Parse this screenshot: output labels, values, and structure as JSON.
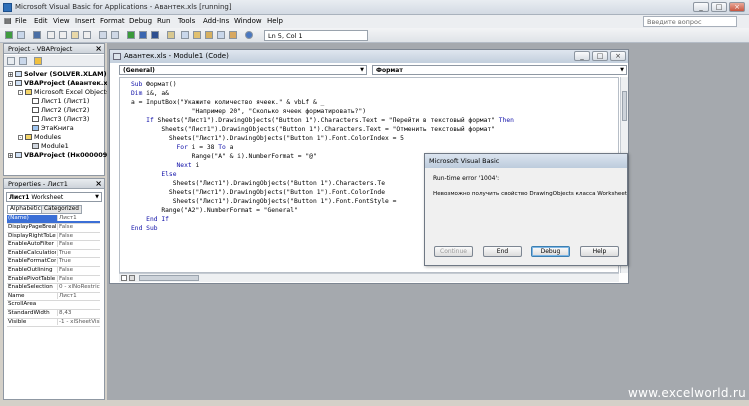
{
  "window": {
    "title": "Microsoft Visual Basic for Applications - Авантек.xls [running]",
    "controls": [
      "_",
      "□",
      "×"
    ]
  },
  "menu": {
    "items": [
      "File",
      "Edit",
      "View",
      "Insert",
      "Format",
      "Debug",
      "Run",
      "Tools",
      "Add-Ins",
      "Window",
      "Help"
    ],
    "ask_placeholder": "Введите вопрос"
  },
  "toolbar": {
    "cursor_position": "Ln 5, Col 1"
  },
  "project_panel": {
    "title": "Project - VBAProject",
    "tree": [
      {
        "label": "Solver (SOLVER.XLAM)",
        "bold": true
      },
      {
        "label": "VBAProject (Авантек.x",
        "bold": true
      },
      {
        "label": "Microsoft Excel Objects",
        "bold": false
      },
      {
        "label": "Лист1 (Лист1)",
        "bold": false
      },
      {
        "label": "Лист2 (Лист2)",
        "bold": false
      },
      {
        "label": "Лист3 (Лист3)",
        "bold": false
      },
      {
        "label": "ЭтаКнига",
        "bold": false
      },
      {
        "label": "Modules",
        "bold": false
      },
      {
        "label": "Module1",
        "bold": false
      },
      {
        "label": "VBAProject (Нк000009",
        "bold": true
      }
    ]
  },
  "properties_panel": {
    "title": "Properties - Лист1",
    "object_name": "Лист1",
    "object_type": "Worksheet",
    "tabs": [
      "Alphabetic",
      "Categorized"
    ],
    "rows": [
      {
        "name": "(Name)",
        "value": "Лист1"
      },
      {
        "name": "DisplayPageBreak",
        "value": "False"
      },
      {
        "name": "DisplayRightToLef",
        "value": "False"
      },
      {
        "name": "EnableAutoFilter",
        "value": "False"
      },
      {
        "name": "EnableCalculation",
        "value": "True"
      },
      {
        "name": "EnableFormatCon",
        "value": "True"
      },
      {
        "name": "EnableOutlining",
        "value": "False"
      },
      {
        "name": "EnablePivotTable",
        "value": "False"
      },
      {
        "name": "EnableSelection",
        "value": "0 - xlNoRestricts"
      },
      {
        "name": "Name",
        "value": "Лист1"
      },
      {
        "name": "ScrollArea",
        "value": ""
      },
      {
        "name": "StandardWidth",
        "value": "8,43"
      },
      {
        "name": "Visible",
        "value": "-1 - xlSheetVisib"
      }
    ]
  },
  "code_window": {
    "title": "Авантек.xls - Module1 (Code)",
    "object_combo": "(General)",
    "proc_combo": "Формат",
    "lines": [
      "Sub Формат()",
      "Dim i&, a&",
      "a = InputBox(\"Укажите количество ячеек.\" & vbLf & _",
      "                \"Например 20\", \"Сколько ячеек форматировать?\")",
      "    If Sheets(\"Лист1\").DrawingObjects(\"Button 1\").Characters.Text = \"Перейти в текстовый формат\" Then",
      "        Sheets(\"Лист1\").DrawingObjects(\"Button 1\").Characters.Text = \"Отменить текстовый формат\"",
      "          Sheets(\"Лист1\").DrawingObjects(\"Button 1\").Font.ColorIndex = 5",
      "            For i = 38 To a",
      "                Range(\"A\" & i).NumberFormat = \"@\"",
      "            Next i",
      "        Else",
      "           Sheets(\"Лист1\").DrawingObjects(\"Button 1\").Characters.Te",
      "          Sheets(\"Лист1\").DrawingObjects(\"Button 1\").Font.ColorInde",
      "           Sheets(\"Лист1\").DrawingObjects(\"Button 1\").Font.FontStyle =",
      "        Range(\"A2\").NumberFormat = \"General\"",
      "    End If",
      "End Sub"
    ]
  },
  "error_dialog": {
    "title": "Microsoft Visual Basic",
    "error_line": "Run-time error '1004':",
    "message": "Невозможно получить свойство DrawingObjects класса Worksheet",
    "buttons": [
      "Continue",
      "End",
      "Debug",
      "Help"
    ]
  },
  "watermark": "www.excelworld.ru"
}
